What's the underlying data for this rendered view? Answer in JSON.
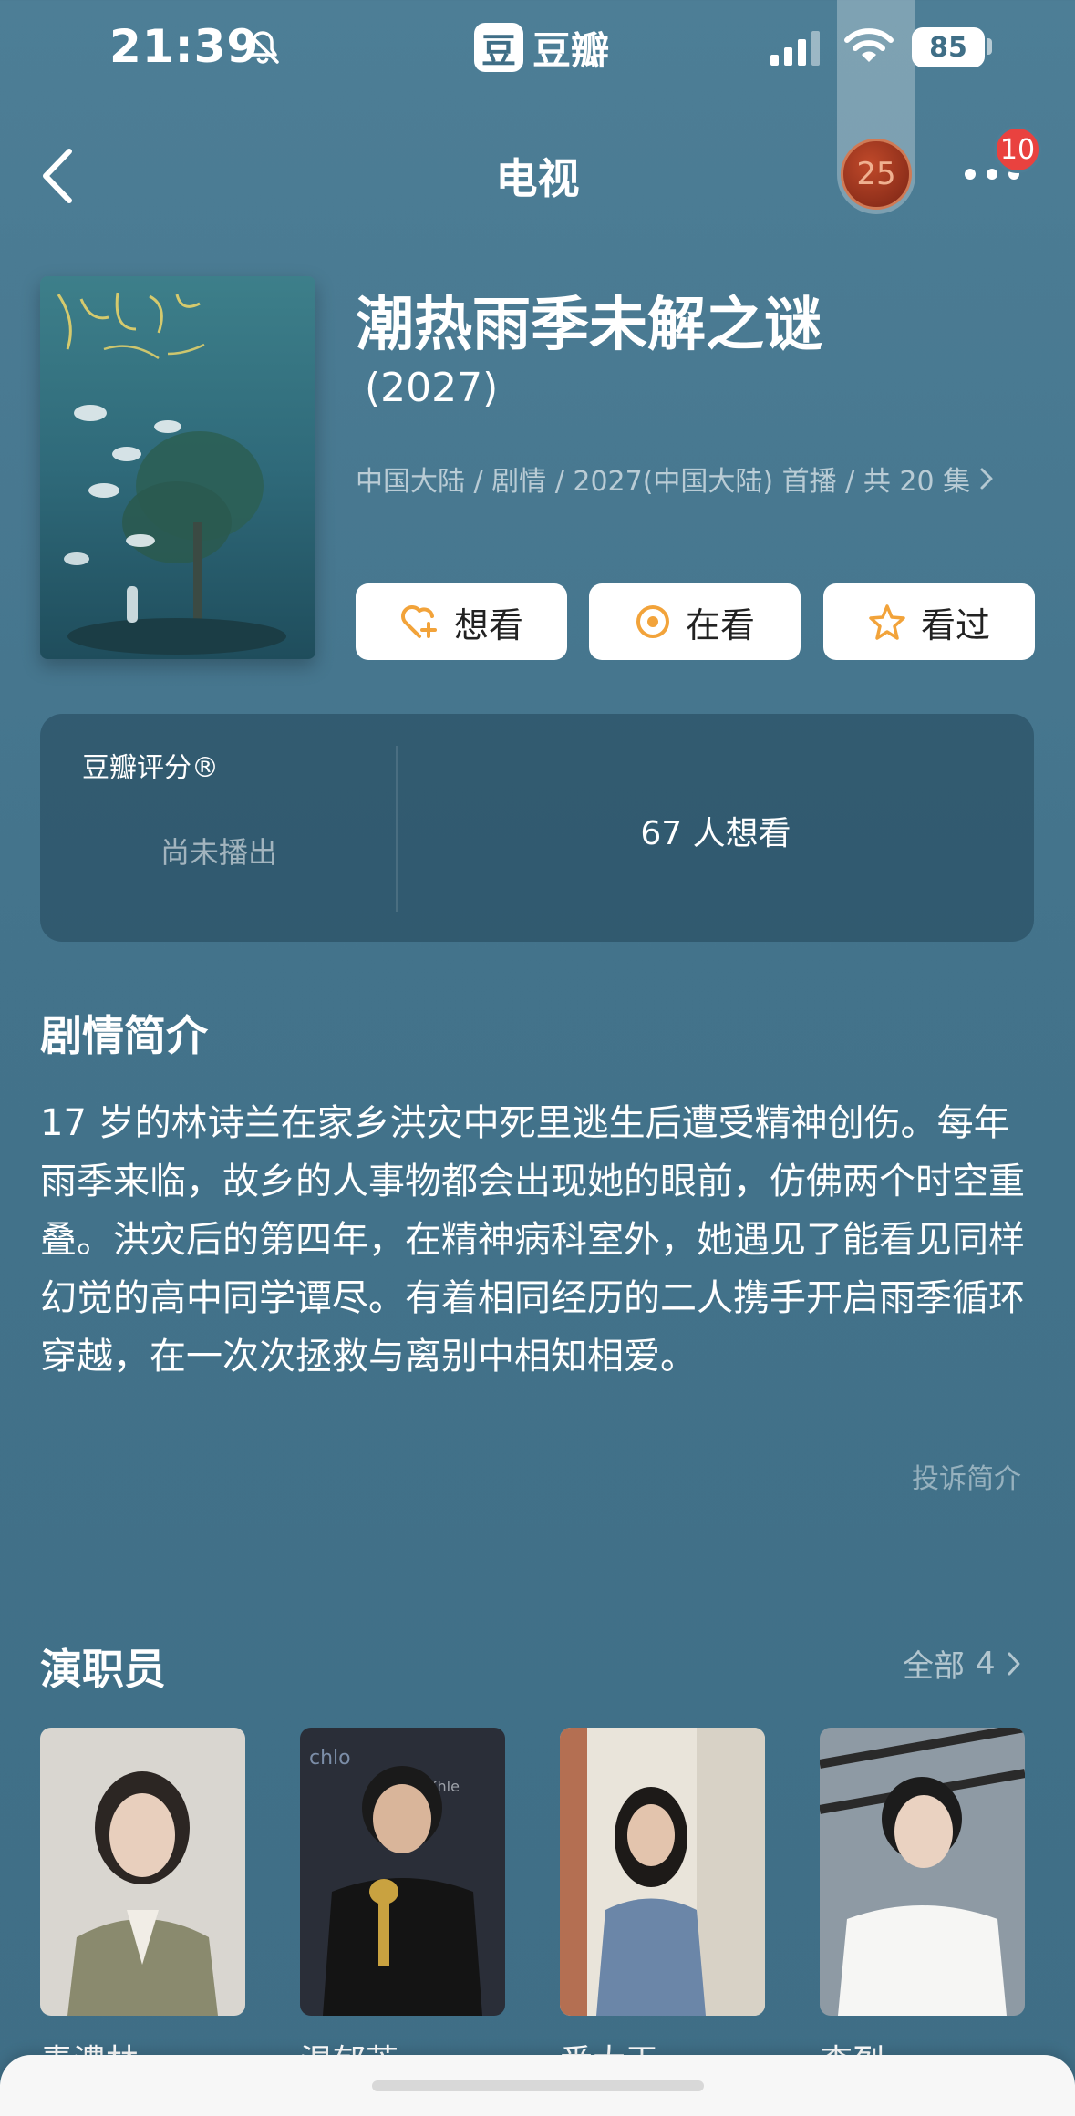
{
  "status_bar": {
    "time": "21:39",
    "app_name": "豆瓣",
    "app_logo_char": "豆",
    "battery": "85",
    "icons": [
      "bell-off-icon",
      "signal-icon",
      "wifi-icon",
      "battery-icon"
    ]
  },
  "nav": {
    "title": "电视",
    "avatar_text": "25",
    "notification_count": "10",
    "icons": [
      "back-icon",
      "more-icon"
    ]
  },
  "subject": {
    "title": "潮热雨季未解之谜",
    "year": "(2027)",
    "meta": "中国大陆 / 剧情 / 2027(中国大陆) 首播 / 共 20 集"
  },
  "actions": [
    {
      "label": "想看",
      "icon": "heart-plus-icon"
    },
    {
      "label": "在看",
      "icon": "target-icon"
    },
    {
      "label": "看过",
      "icon": "star-icon"
    }
  ],
  "rating": {
    "label": "豆瓣评分®",
    "status": "尚未播出",
    "wish_count": "67 人想看"
  },
  "synopsis": {
    "title": "剧情简介",
    "text": "17 岁的林诗兰在家乡洪灾中死里逃生后遭受精神创伤。每年雨季来临，故乡的人事物都会出现她的眼前，仿佛两个时空重叠。洪灾后的第四年，在精神病科室外，她遇见了能看见同样幻觉的高中同学谭尽。有着相同经历的二人携手开启雨季循环穿越，在一次次拯救与离别中相知相爱。",
    "report": "投诉简介"
  },
  "cast": {
    "title": "演职员",
    "all_label": "全部",
    "count": "4",
    "members": [
      {
        "name": "青澧林"
      },
      {
        "name": "温郁芳"
      },
      {
        "name": "番大王"
      },
      {
        "name": "李烈"
      }
    ]
  },
  "colors": {
    "background": "#4d7e96",
    "accent_orange": "#f2a33a",
    "badge_red": "#e9423f"
  }
}
